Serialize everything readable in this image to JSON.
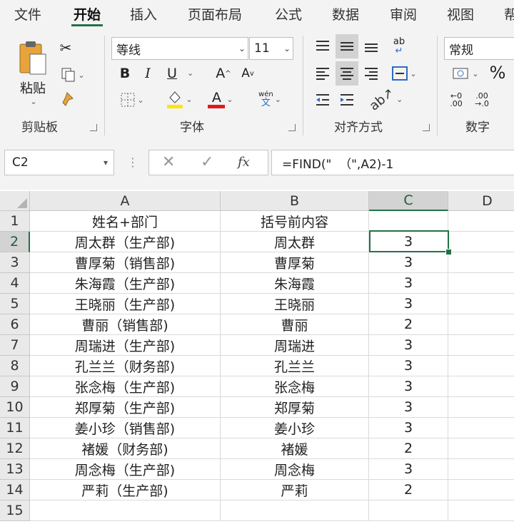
{
  "ribbon_tabs": [
    "文件",
    "开始",
    "插入",
    "页面布局",
    "公式",
    "数据",
    "审阅",
    "视图",
    "帮"
  ],
  "active_tab": "开始",
  "accent_color": "#217346",
  "clipboard": {
    "paste_label": "粘贴",
    "group_label": "剪贴板"
  },
  "font": {
    "name": "等线",
    "size": "11",
    "group_label": "字体",
    "bold": "B",
    "italic": "I",
    "underline": "U",
    "grow": "A",
    "shrink": "A",
    "phonetic_top": "wén",
    "phonetic_bottom": "文",
    "font_color_letter": "A"
  },
  "alignment": {
    "group_label": "对齐方式",
    "wrap_label": "ab"
  },
  "number": {
    "format": "常规",
    "group_label": "数字",
    "percent": "%",
    "inc_top": "←0",
    "inc_bottom": ".00",
    "dec_top": ".00",
    "dec_bottom": "→.0"
  },
  "formula_bar": {
    "name_box": "C2",
    "fx": "fx",
    "formula": "=FIND(\"  （\",A2)-1"
  },
  "columns": [
    "A",
    "B",
    "C",
    "D"
  ],
  "row_numbers": [
    "1",
    "2",
    "3",
    "4",
    "5",
    "6",
    "7",
    "8",
    "9",
    "10",
    "11",
    "12",
    "13",
    "14",
    "15"
  ],
  "rows": [
    [
      "姓名+部门",
      "括号前内容",
      "",
      ""
    ],
    [
      "周太群（生产部)",
      "周太群",
      "3",
      ""
    ],
    [
      "曹厚菊（销售部)",
      "曹厚菊",
      "3",
      ""
    ],
    [
      "朱海霞（生产部)",
      "朱海霞",
      "3",
      ""
    ],
    [
      "王晓丽（生产部)",
      "王晓丽",
      "3",
      ""
    ],
    [
      "曹丽（销售部)",
      "曹丽",
      "2",
      ""
    ],
    [
      "周瑞进（生产部)",
      "周瑞进",
      "3",
      ""
    ],
    [
      "孔兰兰（财务部)",
      "孔兰兰",
      "3",
      ""
    ],
    [
      "张念梅（生产部)",
      "张念梅",
      "3",
      ""
    ],
    [
      "郑厚菊（生产部)",
      "郑厚菊",
      "3",
      ""
    ],
    [
      "姜小珍（销售部)",
      "姜小珍",
      "3",
      ""
    ],
    [
      "褚媛（财务部)",
      "褚媛",
      "2",
      ""
    ],
    [
      "周念梅（生产部)",
      "周念梅",
      "3",
      ""
    ],
    [
      "严莉（生产部)",
      "严莉",
      "2",
      ""
    ],
    [
      "",
      "",
      "",
      ""
    ]
  ]
}
